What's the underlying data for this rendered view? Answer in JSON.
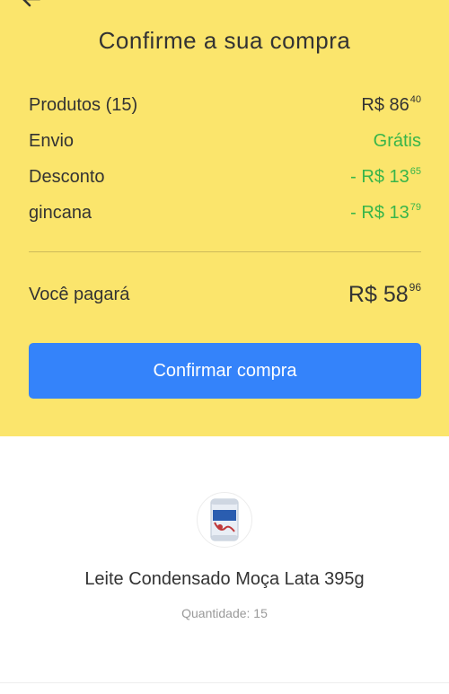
{
  "summary": {
    "title": "Confirme a sua compra",
    "rows": [
      {
        "label": "Produtos (15)",
        "value_main": "R$ 86",
        "value_cents": "40",
        "highlight": false
      },
      {
        "label": "Envio",
        "value_main": "Grátis",
        "value_cents": "",
        "highlight": true
      },
      {
        "label": "Desconto",
        "value_main": "- R$ 13",
        "value_cents": "65",
        "highlight": true
      },
      {
        "label": "gincana",
        "value_main": "- R$ 13",
        "value_cents": "79",
        "highlight": true
      }
    ],
    "total": {
      "label": "Você pagará",
      "value_main": "R$ 58",
      "value_cents": "96"
    },
    "confirm_label": "Confirmar compra"
  },
  "product": {
    "name": "Leite Condensado Moça Lata 395g",
    "quantity": "Quantidade: 15",
    "image_icon": "condensed-milk-can-icon"
  },
  "colors": {
    "header_bg": "#fbe56c",
    "accent_blue": "#3483fa",
    "discount_green": "#39b54a"
  },
  "icons": {
    "back": "back-arrow-icon"
  }
}
